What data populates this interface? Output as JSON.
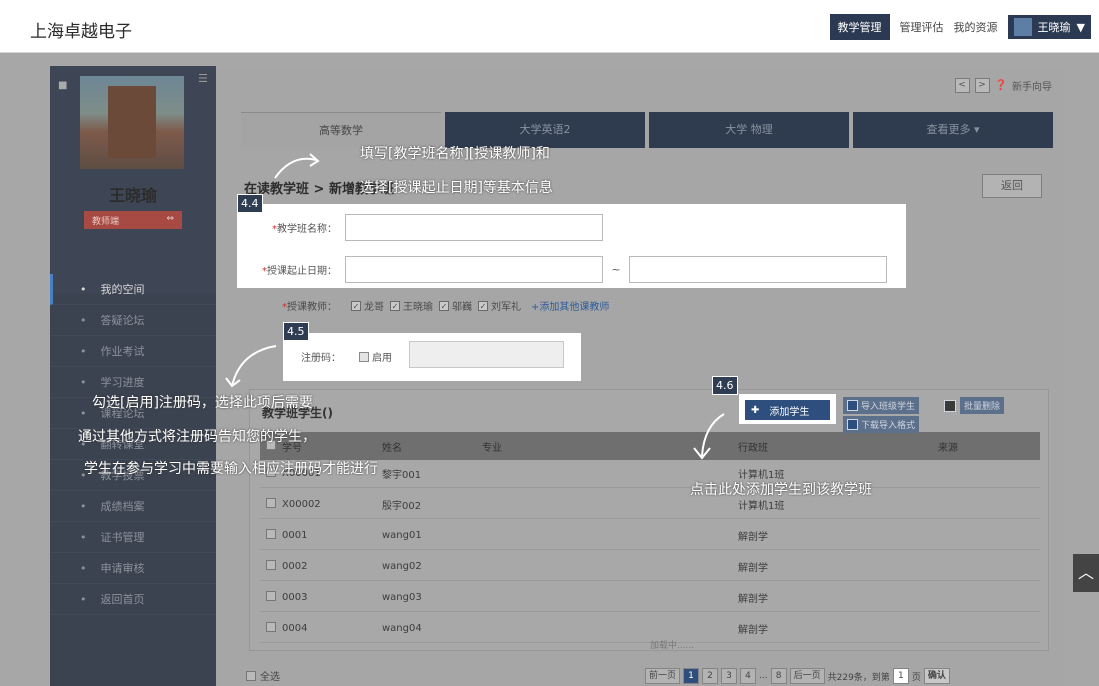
{
  "header": {
    "brand": "上海卓越电子",
    "nav": [
      "教学管理",
      "管理评估",
      "我的资源"
    ],
    "active_nav": "教学管理",
    "user_name": "王晓瑜"
  },
  "sidebar": {
    "name": "王晓瑜",
    "role": "教师端",
    "items": [
      {
        "label": "我的空间",
        "active": true
      },
      {
        "label": "答疑论坛"
      },
      {
        "label": "作业考试"
      },
      {
        "label": "学习进度"
      },
      {
        "label": "课程论坛"
      },
      {
        "label": "翻转课堂"
      },
      {
        "label": "教学投票"
      },
      {
        "label": "成绩档案"
      },
      {
        "label": "证书管理"
      },
      {
        "label": "申请审核"
      },
      {
        "label": "返回首页"
      }
    ]
  },
  "toolbar": {
    "guide": "新手向导"
  },
  "tabs": [
    "高等数学",
    "大学英语2",
    "大学 物理",
    "查看更多"
  ],
  "breadcrumb": "在读教学班 > 新增教学班",
  "back_label": "返回",
  "form": {
    "class_name_label": "教学班名称：",
    "date_label": "授课起止日期：",
    "date_sep": "~",
    "teacher_label": "授课教师：",
    "teachers": [
      "龙哥",
      "王晓瑜",
      "邬巍",
      "刘军礼"
    ],
    "add_teacher": "+添加其他课教师",
    "reg_code_label": "注册码：",
    "reg_enable": "启用"
  },
  "students": {
    "title": "教学班学生()",
    "add_button": "添加学生",
    "import_class": "导入班级学生",
    "download_template": "下载导入格式",
    "batch_delete": "批量删除",
    "columns": [
      "学号",
      "姓名",
      "专业",
      "行政班",
      "来源"
    ],
    "rows": [
      [
        "X00001",
        "黎宇001",
        "",
        "计算机1班",
        ""
      ],
      [
        "X00002",
        "殷宇002",
        "",
        "计算机1班",
        ""
      ],
      [
        "0001",
        "wang01",
        "",
        "解剖学",
        ""
      ],
      [
        "0002",
        "wang02",
        "",
        "解剖学",
        ""
      ],
      [
        "0003",
        "wang03",
        "",
        "解剖学",
        ""
      ],
      [
        "0004",
        "wang04",
        "",
        "解剖学",
        ""
      ]
    ],
    "loading": "加载中......"
  },
  "footer": {
    "select_all": "全选",
    "prev": "前一页",
    "pages": [
      "1",
      "2",
      "3",
      "4",
      "...",
      "8"
    ],
    "next": "后一页",
    "total": "共229条，到第",
    "page_input": "1",
    "page_unit": "页",
    "confirm": "确认"
  },
  "annotations": {
    "tag_44": "4.4",
    "tag_45": "4.5",
    "tag_46": "4.6",
    "note_44_line1": "填写[教学班名称][授课教师]和",
    "note_44_line2": "选择[授课起止日期]等基本信息",
    "note_45_line1": "勾选[启用]注册码，选择此项后需要",
    "note_45_line2": "通过其他方式将注册码告知您的学生，",
    "note_45_line3": "学生在参与学习中需要输入相应注册码才能进行",
    "note_46": "点击此处添加学生到该教学班"
  }
}
